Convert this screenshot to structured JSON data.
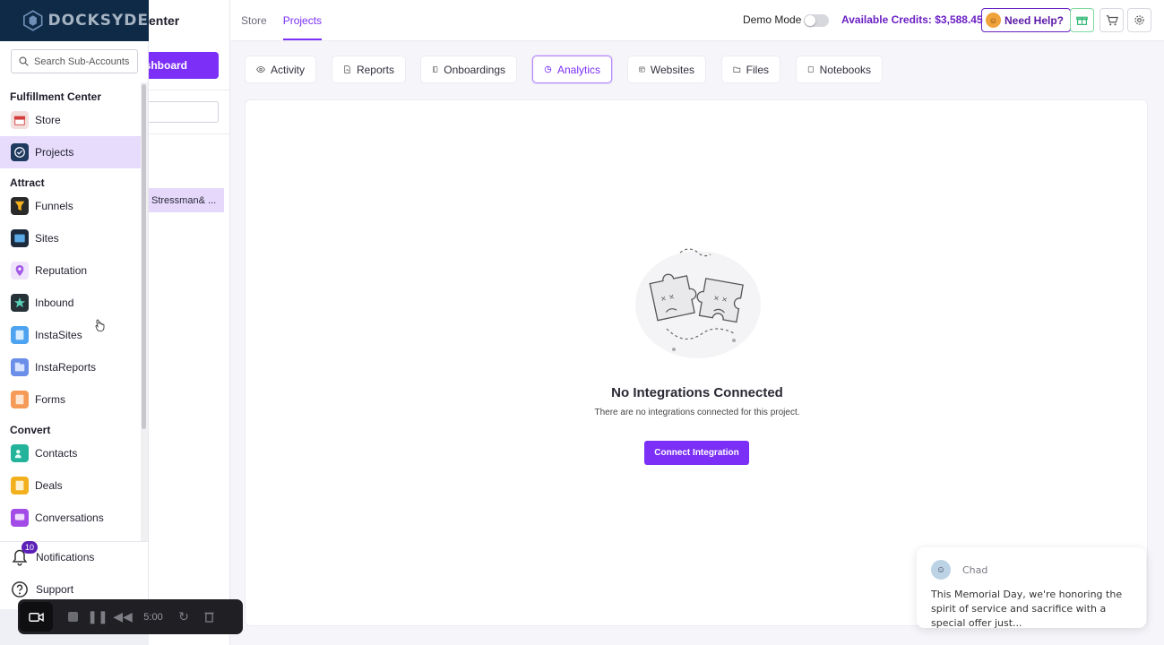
{
  "brand": {
    "logo_text": "DOCKSYDE",
    "color_navy": "#0e2a47",
    "accent": "#7b2ff7"
  },
  "topbar": {
    "nav": [
      {
        "label": "Store"
      },
      {
        "label": "Projects"
      }
    ],
    "demo_mode_label": "Demo Mode",
    "credits": "Available Credits: $3,588.45",
    "help_label": "Need Help?"
  },
  "middle": {
    "title_partial": "enter",
    "dashboard_partial": "shboard",
    "selected_item": "Stressman& ..."
  },
  "tabs": [
    {
      "label": "Activity",
      "icon": "eye-icon"
    },
    {
      "label": "Reports",
      "icon": "report-icon"
    },
    {
      "label": "Onboardings",
      "icon": "book-icon"
    },
    {
      "label": "Analytics",
      "icon": "pie-chart-icon"
    },
    {
      "label": "Websites",
      "icon": "website-icon"
    },
    {
      "label": "Files",
      "icon": "folder-icon"
    },
    {
      "label": "Notebooks",
      "icon": "notebook-icon"
    }
  ],
  "empty_state": {
    "title": "No Integrations Connected",
    "subtitle": "There are no integrations connected for this project.",
    "button": "Connect Integration"
  },
  "sidebar": {
    "search_placeholder": "Search Sub-Accounts",
    "sections": [
      {
        "title": "Fulfillment Center",
        "items": [
          "Store",
          "Projects"
        ]
      },
      {
        "title": "Attract",
        "items": [
          "Funnels",
          "Sites",
          "Reputation",
          "Inbound",
          "InstaSites",
          "InstaReports",
          "Forms"
        ]
      },
      {
        "title": "Convert",
        "items": [
          "Contacts",
          "Deals",
          "Conversations"
        ]
      }
    ],
    "notifications_label": "Notifications",
    "notifications_count": "10",
    "support_label": "Support"
  },
  "recorder": {
    "time": "5:00"
  },
  "chat": {
    "sender": "Chad",
    "message": "This Memorial Day, we're honoring the spirit of service and sacrifice with a special offer just..."
  }
}
